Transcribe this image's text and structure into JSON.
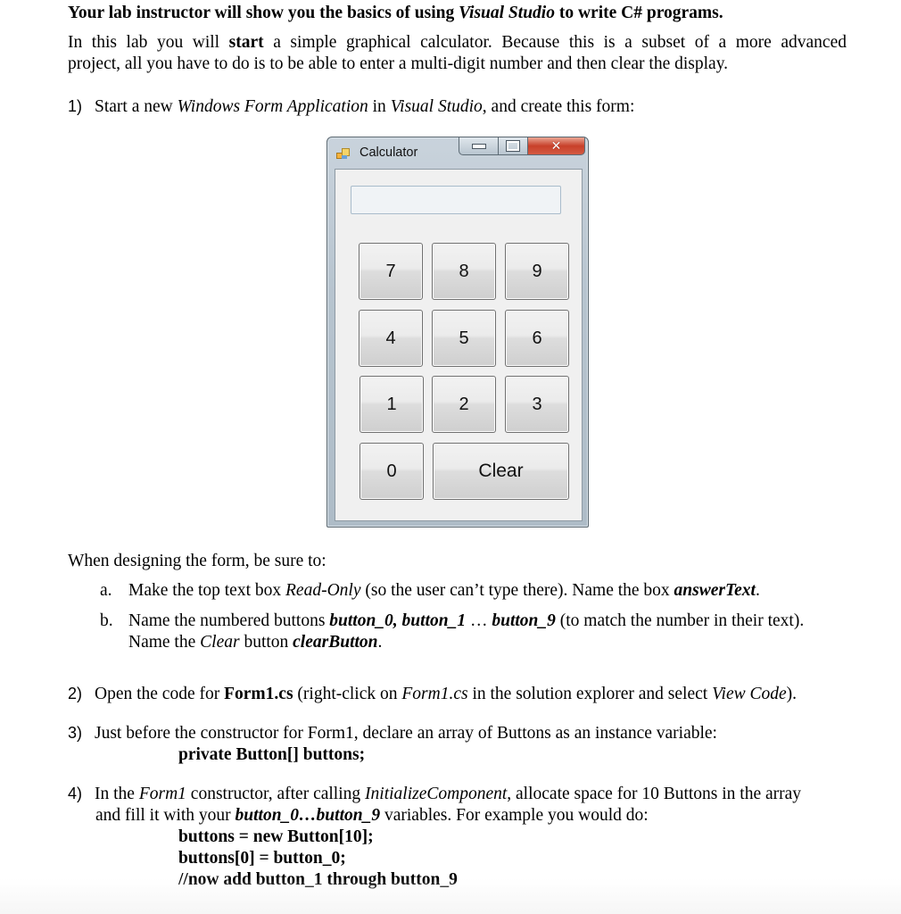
{
  "document": {
    "heading": {
      "pre": "Your lab instructor will show you the basics of using ",
      "app": "Visual Studio",
      "post": " to write C# programs."
    },
    "intro": {
      "pre": "In this lab you will ",
      "bold": "start",
      "line1_post": " a simple graphical calculator. Because this is a subset of a more advanced",
      "line2": "project, all you have to do is to be able to enter a multi-digit number and then clear the display."
    },
    "step1": {
      "num": "1)",
      "pre": "Start a new ",
      "app_type": "Windows Form Application",
      "mid": " in ",
      "app": "Visual Studio",
      "post": ", and create this form:"
    },
    "designing": "When designing the form, be sure to:",
    "sub_a": {
      "letter": "a.",
      "pre": "Make the top text box ",
      "ro": "Read-Only",
      "mid": " (so the user can’t type there).  Name the box ",
      "name": "answerText",
      "post": "."
    },
    "sub_b": {
      "letter": "b.",
      "pre": "Name the numbered buttons ",
      "names": "button_0, button_1",
      "ellipsis": " … ",
      "last": "button_9",
      "post": " (to match the number in their text).",
      "line2_pre": "Name the ",
      "clear": "Clear",
      "line2_mid": " button ",
      "clear_name": "clearButton",
      "line2_post": "."
    },
    "step2": {
      "num": "2)",
      "pre": "Open the code for ",
      "file": "Form1.cs",
      "mid": " (right-click on ",
      "file_i": "Form1.cs",
      "mid2": " in the solution explorer and select ",
      "action": "View Code",
      "post": ")."
    },
    "step3": {
      "num": "3)",
      "text": "Just before the constructor for Form1, declare an array of Buttons as an instance variable:",
      "code": "private Button[] buttons;"
    },
    "step4": {
      "num": "4)",
      "pre": "In the ",
      "ctor": "Form1",
      "mid": " constructor, after calling ",
      "init": "InitializeComponent",
      "post": ", allocate space for 10 Buttons in the array",
      "line2_pre": "and fill it with your ",
      "vars": "button_0…button_9",
      "line2_post": " variables.  For example you would do:",
      "code": [
        "buttons = new Button[10];",
        "buttons[0] = button_0;",
        "//now add button_1 through button_9"
      ]
    }
  },
  "calculator_window": {
    "title": "Calculator",
    "answer_value": "",
    "controls": {
      "minimize": "minimize",
      "maximize": "maximize",
      "close": "close"
    },
    "keys": [
      "7",
      "8",
      "9",
      "4",
      "5",
      "6",
      "1",
      "2",
      "3",
      "0",
      "Clear"
    ]
  }
}
